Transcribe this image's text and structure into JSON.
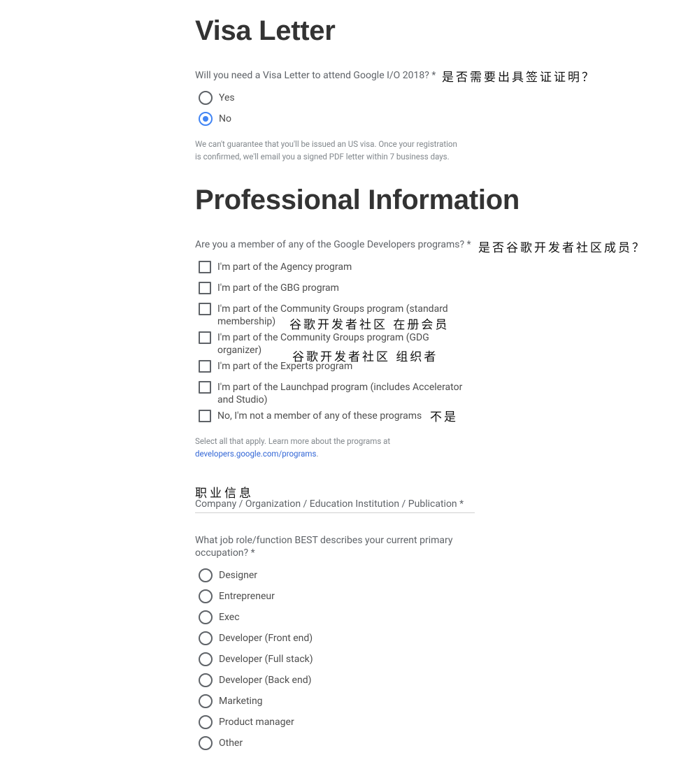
{
  "visa": {
    "title": "Visa Letter",
    "question": "Will you need a Visa Letter to attend Google I/O 2018? *",
    "annotation": "是否需要出具签证证明？",
    "options": [
      {
        "label": "Yes",
        "checked": false
      },
      {
        "label": "No",
        "checked": true
      }
    ],
    "help_line1": "We can't guarantee that you'll be issued an US visa. Once your registration",
    "help_line2": "is confirmed, we'll email you a signed PDF letter within 7 business days."
  },
  "professional": {
    "title": "Professional Information",
    "programs_question": "Are you a member of any of the Google Developers programs? *",
    "programs_annotation": "是否谷歌开发者社区成员？",
    "programs": [
      {
        "label": "I'm part of the Agency program"
      },
      {
        "label": "I'm part of the GBG program"
      },
      {
        "label": "I'm part of the Community Groups program (standard membership)",
        "annotation": "谷歌开发者社区 在册会员"
      },
      {
        "label": "I'm part of the Community Groups program (GDG organizer)",
        "annotation": "谷歌开发者社区 组织者"
      },
      {
        "label": "I'm part of the Experts program"
      },
      {
        "label": "I'm part of the Launchpad program (includes Accelerator and Studio)"
      },
      {
        "label": "No, I'm not a member of any of these programs",
        "annotation": "不是"
      }
    ],
    "programs_help": "Select all that apply. Learn more about the programs at",
    "programs_link": "developers.google.com/programs",
    "programs_link_suffix": ".",
    "section_annotation": "职业信息",
    "company_label": "Company / Organization / Education Institution / Publication *",
    "role_question_line1": "What job role/function BEST describes your current primary",
    "role_question_line2": "occupation? *",
    "roles": [
      {
        "label": "Designer"
      },
      {
        "label": "Entrepreneur"
      },
      {
        "label": "Exec"
      },
      {
        "label": "Developer (Front end)"
      },
      {
        "label": "Developer (Full stack)"
      },
      {
        "label": "Developer (Back end)"
      },
      {
        "label": "Marketing"
      },
      {
        "label": "Product manager"
      },
      {
        "label": "Other"
      }
    ]
  }
}
